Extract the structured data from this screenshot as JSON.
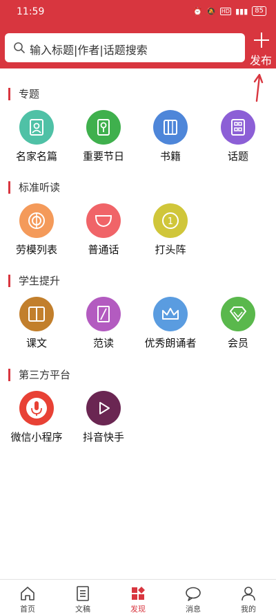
{
  "status_bar": {
    "time": "11:59",
    "battery": "85"
  },
  "search": {
    "placeholder": "输入标题|作者|话题搜索"
  },
  "publish": {
    "label": "发布"
  },
  "sections": [
    {
      "title": "专题",
      "items": [
        {
          "label": "名家名篇",
          "icon": "portrait-icon",
          "color": "#4fc1a6"
        },
        {
          "label": "重要节日",
          "icon": "lantern-icon",
          "color": "#3fb04d"
        },
        {
          "label": "书籍",
          "icon": "book-icon",
          "color": "#4e86d9"
        },
        {
          "label": "话题",
          "icon": "grid-icon",
          "color": "#8c5fd6"
        }
      ]
    },
    {
      "title": "标准听读",
      "items": [
        {
          "label": "劳模列表",
          "icon": "target-icon",
          "color": "#f49a5a"
        },
        {
          "label": "普通话",
          "icon": "bowl-icon",
          "color": "#f06468"
        },
        {
          "label": "打头阵",
          "icon": "coin-icon",
          "color": "#d0c63a"
        }
      ]
    },
    {
      "title": "学生提升",
      "items": [
        {
          "label": "课文",
          "icon": "open-book-icon",
          "color": "#c27f2c"
        },
        {
          "label": "范读",
          "icon": "pen-icon",
          "color": "#b35bc0"
        },
        {
          "label": "优秀朗诵者",
          "icon": "crown-icon",
          "color": "#5a9ce0"
        },
        {
          "label": "会员",
          "icon": "diamond-icon",
          "color": "#5ab84c"
        }
      ]
    },
    {
      "title": "第三方平台",
      "items": [
        {
          "label": "微信小程序",
          "icon": "microphone-icon",
          "color": "#e84135"
        },
        {
          "label": "抖音快手",
          "icon": "play-icon",
          "color": "#6a2652"
        }
      ]
    }
  ],
  "tabbar": [
    {
      "label": "首页",
      "icon": "home-icon"
    },
    {
      "label": "文稿",
      "icon": "document-icon"
    },
    {
      "label": "发现",
      "icon": "discover-icon",
      "active": true
    },
    {
      "label": "消息",
      "icon": "message-icon"
    },
    {
      "label": "我的",
      "icon": "profile-icon"
    }
  ],
  "colors": {
    "brand": "#d8363f"
  }
}
